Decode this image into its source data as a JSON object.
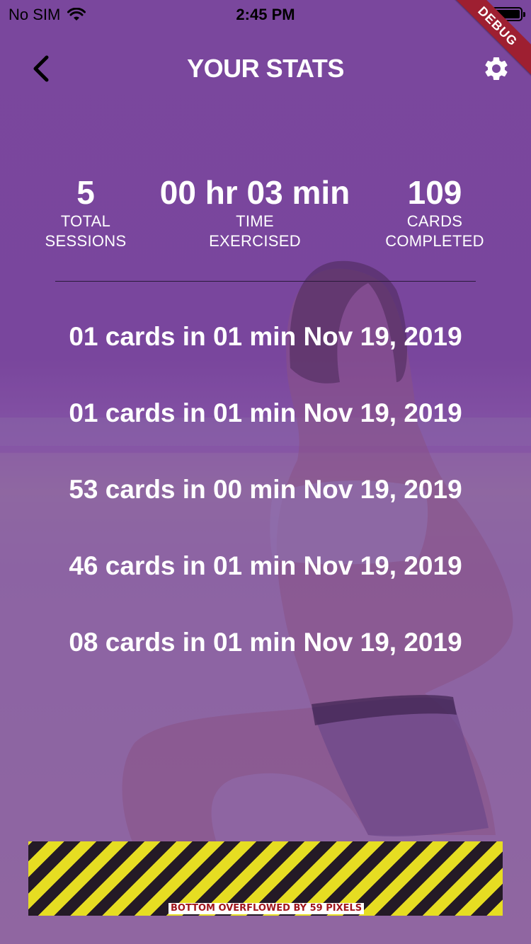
{
  "status_bar": {
    "carrier": "No SIM",
    "time": "2:45 PM"
  },
  "debug_banner": "DEBUG",
  "app_bar": {
    "title": "YOUR STATS"
  },
  "stats": {
    "total_sessions": {
      "value": "5",
      "label_line1": "TOTAL",
      "label_line2": "SESSIONS"
    },
    "time_exercised": {
      "value": "00 hr 03 min",
      "label_line1": "TIME",
      "label_line2": "EXERCISED"
    },
    "cards_completed": {
      "value": "109",
      "label_line1": "CARDS",
      "label_line2": "COMPLETED"
    }
  },
  "sessions": [
    "01 cards in 01 min Nov 19, 2019",
    "01 cards in 01 min Nov 19, 2019",
    "53 cards in 00 min Nov 19, 2019",
    "46 cards in 01 min Nov 19, 2019",
    "08 cards in 01 min Nov 19, 2019"
  ],
  "overflow_warning": "BOTTOM OVERFLOWED BY 59 PIXELS",
  "colors": {
    "background": "#7a4a98",
    "text": "#ffffff",
    "debug_ribbon": "#9e1f31",
    "warning_yellow": "#e6dd22",
    "warning_dark": "#241a26",
    "warning_text": "#a0161d"
  },
  "icons": {
    "back": "chevron-left-icon",
    "settings": "gear-icon",
    "wifi": "wifi-icon",
    "battery": "battery-icon"
  }
}
